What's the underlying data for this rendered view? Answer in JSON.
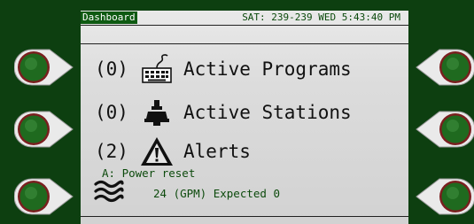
{
  "header": {
    "tab_label": "Dashboard",
    "datetime": "SAT: 239-239 WED 5:43:40 PM"
  },
  "rows": [
    {
      "count": "(0)",
      "label": "Active Programs",
      "icon": "controller-keyboard-icon"
    },
    {
      "count": "(0)",
      "label": "Active Stations",
      "icon": "sprinkler-valve-icon"
    },
    {
      "count": "(2)",
      "label": "Alerts",
      "icon": "warning-triangle-icon"
    }
  ],
  "alert_detail": "A: Power reset",
  "flow": {
    "icon": "water-flow-icon",
    "text": "24 (GPM) Expected 0"
  },
  "colors": {
    "bezel": "#0d3f10",
    "screen": "#dcdcdc",
    "accent_green": "#0e5a12",
    "button_rim": "#8b2a2a",
    "button_body": "#1f6a1f"
  }
}
